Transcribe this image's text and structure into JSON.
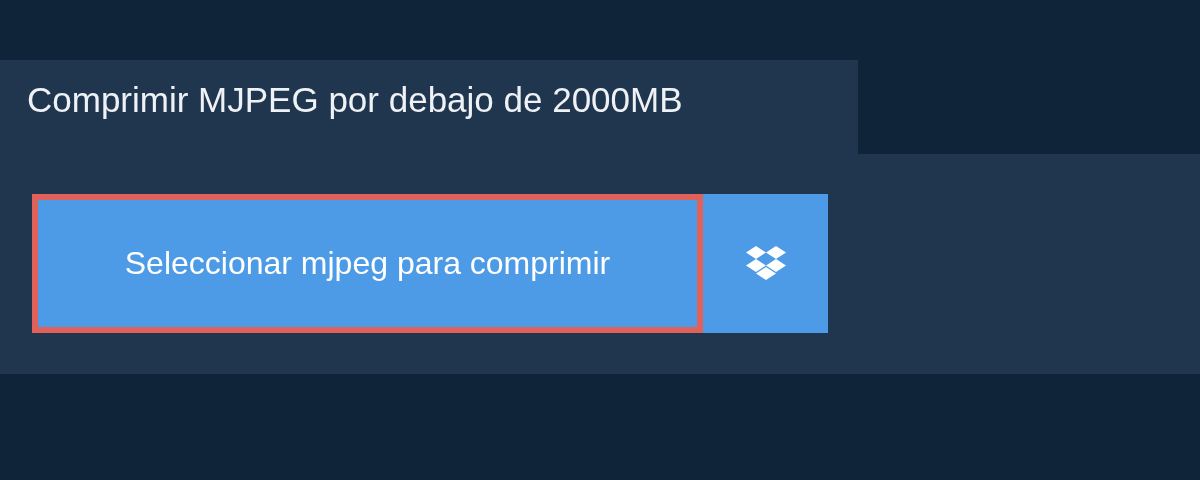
{
  "title": "Comprimir MJPEG por debajo de 2000MB",
  "select_button": {
    "label": "Seleccionar mjpeg para comprimir",
    "highlighted": true
  }
}
